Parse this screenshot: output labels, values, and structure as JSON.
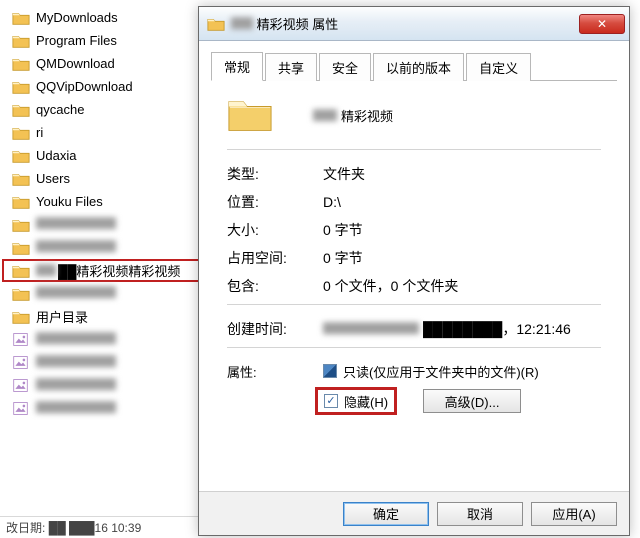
{
  "colors": {
    "highlight_border": "#c02020"
  },
  "file_list": {
    "items": [
      {
        "label": "MyDownloads",
        "kind": "folder"
      },
      {
        "label": "Program Files",
        "kind": "folder"
      },
      {
        "label": "QMDownload",
        "kind": "folder"
      },
      {
        "label": "QQVipDownload",
        "kind": "folder"
      },
      {
        "label": "qycache",
        "kind": "folder"
      },
      {
        "label": "ri",
        "kind": "folder"
      },
      {
        "label": "Udaxia",
        "kind": "folder"
      },
      {
        "label": "Users",
        "kind": "folder"
      },
      {
        "label": "Youku Files",
        "kind": "folder"
      },
      {
        "label": "██████",
        "kind": "folder",
        "obscured": true
      },
      {
        "label": "██████████",
        "kind": "folder",
        "obscured": true
      },
      {
        "label": "██精彩视频",
        "kind": "folder",
        "selected": true
      },
      {
        "label": "███",
        "kind": "folder",
        "obscured": true
      },
      {
        "label": "用户目录",
        "kind": "folder"
      },
      {
        "label": "██ ██",
        "kind": "image",
        "obscured": true
      },
      {
        "label": "██████",
        "kind": "image",
        "obscured": true
      },
      {
        "label": "██████████",
        "kind": "image",
        "obscured": true
      },
      {
        "label": "██████",
        "kind": "image",
        "obscured": true
      }
    ],
    "status_prefix": "改日期:",
    "status_date": "██ ███16 10:39"
  },
  "dialog": {
    "title_prefix": "██",
    "title": "精彩视频 属性",
    "tabs": [
      {
        "label": "常规",
        "active": true
      },
      {
        "label": "共享"
      },
      {
        "label": "安全"
      },
      {
        "label": "以前的版本"
      },
      {
        "label": "自定义"
      }
    ],
    "folder_name_prefix": "██",
    "folder_name": "精彩视频",
    "rows": {
      "type_label": "类型:",
      "type_value": "文件夹",
      "loc_label": "位置:",
      "loc_value": "D:\\",
      "size_label": "大小:",
      "size_value": "0 字节",
      "ondisk_label": "占用空间:",
      "ondisk_value": "0 字节",
      "contains_label": "包含:",
      "contains_value": "0 个文件，0 个文件夹",
      "created_label": "创建时间:",
      "created_value": "████████，12:21:46"
    },
    "attributes": {
      "label": "属性:",
      "readonly_label": "只读(仅应用于文件夹中的文件)(R)",
      "readonly_state": "mixed",
      "hidden_label": "隐藏(H)",
      "hidden_state": "checked",
      "advanced_btn": "高级(D)..."
    },
    "buttons": {
      "ok": "确定",
      "cancel": "取消",
      "apply": "应用(A)"
    }
  }
}
